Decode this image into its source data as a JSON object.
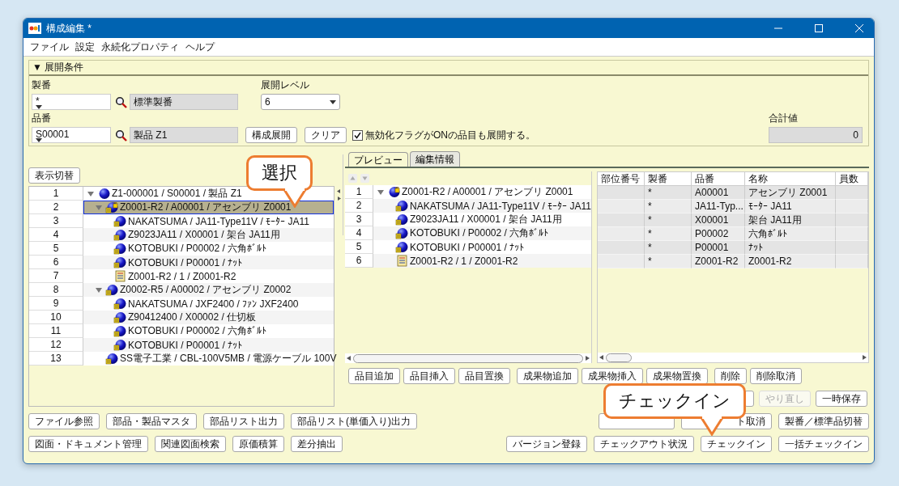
{
  "window": {
    "title": "構成編集 *"
  },
  "menu": [
    "ファイル",
    "設定",
    "永続化プロパティ",
    "ヘルプ"
  ],
  "conditions": {
    "header": "▼ 展開条件",
    "seiban": {
      "label": "製番",
      "value": "*",
      "name": "標準製番"
    },
    "level": {
      "label": "展開レベル",
      "value": "6"
    },
    "hinban": {
      "label": "品番",
      "value": "S00001",
      "name": "製品 Z1"
    },
    "expand_button": "構成展開",
    "clear_button": "クリア",
    "include_disabled": {
      "label": "無効化フラグがONの品目も展開する。",
      "checked": true
    },
    "total": {
      "label": "合計値",
      "value": "0"
    }
  },
  "left_tree": {
    "toggle_button": "表示切替",
    "rows": [
      {
        "num": "1",
        "label": "Z1-000001 / S00001 / 製品 Z1",
        "kind": "root",
        "locked": false,
        "selected": false,
        "expanded": true,
        "children": [
          {
            "num": "2",
            "label": "Z0001-R2 / A00001 / アセンブリ Z0001",
            "kind": "part",
            "locked": true,
            "selected": true,
            "expanded": true,
            "children": [
              {
                "num": "3",
                "label": "NAKATSUMA / JA11-Type11V / ﾓｰﾀｰ JA11",
                "kind": "part",
                "locked": false,
                "selected": false
              },
              {
                "num": "4",
                "label": "Z9023JA11 / X00001 / 架台 JA11用",
                "kind": "part",
                "locked": false,
                "selected": false
              },
              {
                "num": "5",
                "label": "KOTOBUKI / P00002 / 六角ﾎﾞﾙﾄ",
                "kind": "part",
                "locked": false,
                "selected": false
              },
              {
                "num": "6",
                "label": "KOTOBUKI / P00001 / ﾅｯﾄ",
                "kind": "part",
                "locked": false,
                "selected": false
              },
              {
                "num": "7",
                "label": "Z0001-R2 / 1 / Z0001-R2",
                "kind": "document",
                "selected": false
              }
            ]
          },
          {
            "num": "8",
            "label": "Z0002-R5 / A00002 / アセンブリ Z0002",
            "kind": "part",
            "locked": false,
            "selected": false,
            "expanded": true,
            "children": [
              {
                "num": "9",
                "label": "NAKATSUMA / JXF2400 / ﾌｧﾝ JXF2400",
                "kind": "part",
                "locked": false,
                "selected": false
              },
              {
                "num": "10",
                "label": "Z90412400 / X00002 / 仕切板",
                "kind": "part",
                "locked": false,
                "selected": false
              },
              {
                "num": "11",
                "label": "KOTOBUKI / P00002 / 六角ﾎﾞﾙﾄ",
                "kind": "part",
                "locked": false,
                "selected": false
              },
              {
                "num": "12",
                "label": "KOTOBUKI / P00001 / ﾅｯﾄ",
                "kind": "part",
                "locked": false,
                "selected": false
              }
            ]
          },
          {
            "num": "13",
            "label": "SS電子工業 / CBL-100V5MB / 電源ケーブル 100V",
            "kind": "part",
            "locked": false,
            "selected": false
          }
        ]
      }
    ]
  },
  "tabs": [
    {
      "label": "プレビュー",
      "selected": false
    },
    {
      "label": "編集情報",
      "selected": true
    }
  ],
  "right_tree": {
    "rows": [
      {
        "num": "1",
        "label": "Z0001-R2 / A00001 / アセンブリ Z0001",
        "kind": "root",
        "locked": true,
        "selected": false,
        "expanded": true,
        "children": [
          {
            "num": "2",
            "label": "NAKATSUMA / JA11-Type11V / ﾓｰﾀｰ JA11",
            "kind": "part",
            "locked": false,
            "selected": false
          },
          {
            "num": "3",
            "label": "Z9023JA11 / X00001 / 架台 JA11用",
            "kind": "part",
            "locked": false,
            "selected": false
          },
          {
            "num": "4",
            "label": "KOTOBUKI / P00002 / 六角ﾎﾞﾙﾄ",
            "kind": "part",
            "locked": false,
            "selected": false
          },
          {
            "num": "5",
            "label": "KOTOBUKI / P00001 / ﾅｯﾄ",
            "kind": "part",
            "locked": false,
            "selected": false
          },
          {
            "num": "6",
            "label": "Z0001-R2 / 1 / Z0001-R2",
            "kind": "document",
            "selected": false
          }
        ]
      }
    ]
  },
  "table": {
    "columns": [
      "部位番号",
      "製番",
      "品番",
      "名称",
      "員数"
    ],
    "rows": [
      [
        "",
        "*",
        "A00001",
        "アセンブリ Z0001",
        ""
      ],
      [
        "",
        "*",
        "JA11-Typ...",
        "ﾓｰﾀｰ JA11",
        ""
      ],
      [
        "",
        "*",
        "X00001",
        "架台 JA11用",
        ""
      ],
      [
        "",
        "*",
        "P00002",
        "六角ﾎﾞﾙﾄ",
        ""
      ],
      [
        "",
        "*",
        "P00001",
        "ﾅｯﾄ",
        ""
      ],
      [
        "",
        "*",
        "Z0001-R2",
        "Z0001-R2",
        ""
      ]
    ]
  },
  "edit_buttons": [
    [
      {
        "label": "品目追加",
        "disabled": false
      },
      {
        "label": "品目挿入",
        "disabled": false
      },
      {
        "label": "品目置換",
        "disabled": false
      }
    ],
    [
      {
        "label": "成果物追加",
        "disabled": false
      },
      {
        "label": "成果物挿入",
        "disabled": false
      },
      {
        "label": "成果物置換",
        "disabled": false
      }
    ],
    [
      {
        "label": "削除",
        "disabled": false
      },
      {
        "label": "削除取消",
        "disabled": false
      }
    ]
  ],
  "undo_buttons": [
    {
      "kind": "edge"
    },
    {
      "label": "やり直し",
      "disabled": true
    },
    {
      "label": "一時保存",
      "disabled": false
    }
  ],
  "left_buttons": [
    [
      {
        "label": "ファイル参照",
        "disabled": false
      },
      {
        "label": "部品・製品マスタ",
        "disabled": false
      },
      {
        "label": "部品リスト出力",
        "disabled": false
      },
      {
        "label": "部品リスト(単価入り)出力",
        "disabled": false
      }
    ],
    [
      {
        "label": "図面・ドキュメント管理",
        "disabled": false
      },
      {
        "label": "関連図面検索",
        "disabled": false
      },
      {
        "label": "原価積算",
        "disabled": false
      },
      {
        "label": "差分抽出",
        "disabled": false
      }
    ]
  ],
  "right_buttons": [
    [
      {
        "kind": "covered"
      },
      {
        "kind": "cut",
        "label": "ト取消",
        "disabled": false
      },
      {
        "label": "製番／標準品切替",
        "disabled": false
      }
    ],
    [
      {
        "label": "バージョン登録",
        "disabled": false
      },
      {
        "label": "チェックアウト状況",
        "disabled": false
      },
      {
        "label": "チェックイン",
        "disabled": false
      },
      {
        "label": "一括チェックイン",
        "disabled": false
      }
    ]
  ],
  "callouts": [
    {
      "text": "選択"
    },
    {
      "text": "チェックイン"
    }
  ]
}
